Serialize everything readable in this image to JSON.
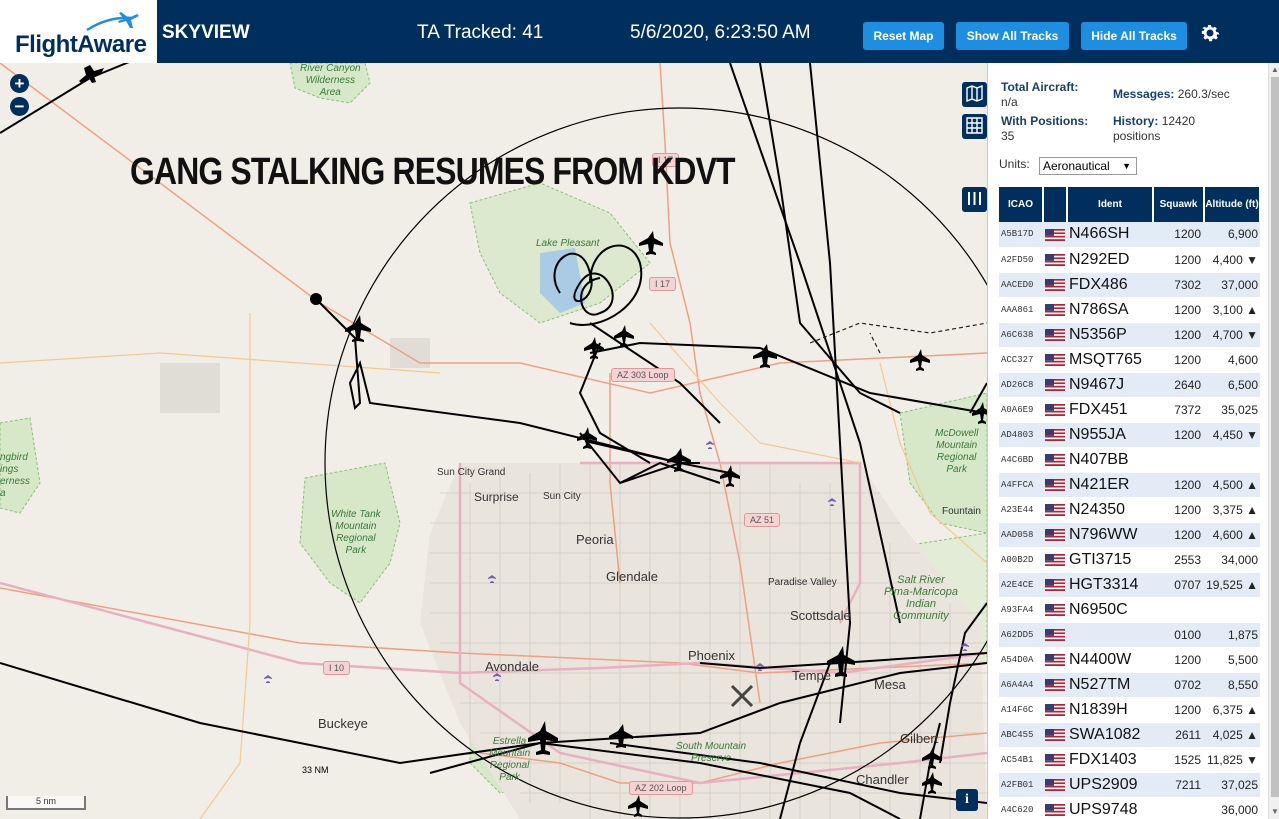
{
  "header": {
    "logo_text": "FlightAware",
    "app_name": "SKYVIEW",
    "ta_tracked": "TA Tracked: 41",
    "datetime": "5/6/2020, 6:23:50 AM",
    "reset_label": "Reset Map",
    "show_label": "Show All Tracks",
    "hide_label": "Hide All Tracks",
    "accent_color": "#1e8fe0",
    "bar_color": "#002f5d"
  },
  "map": {
    "overlay_title": "GANG STALKING RESUMES FROM KDVT",
    "range_ring_label": "33 NM",
    "scale_label": "5 nm",
    "zoom_in": "+",
    "zoom_out": "−",
    "info": "i",
    "places": {
      "surprise": "Surprise",
      "sun_city": "Sun City",
      "sun_city_grand": "Sun City Grand",
      "peoria": "Peoria",
      "glendale": "Glendale",
      "phoenix": "Phoenix",
      "tempe": "Tempe",
      "mesa": "Mesa",
      "scottsdale": "Scottsdale",
      "paradise_valley": "Paradise Valley",
      "avondale": "Avondale",
      "buckeye": "Buckeye",
      "gilbert": "Gilbert",
      "chandler": "Chandler",
      "fountain": "Fountain"
    },
    "parks": {
      "hassayampa": "River Canyon\nWilderness\nArea",
      "white_tank": "White Tank\nMountain\nRegional\nPark",
      "mcdowell": "McDowell\nMountain\nRegional\nPark",
      "estrella": "Estrella\nMountain\nRegional\nPark",
      "south_mountain": "South Mountain\nPreserve",
      "lake_pleasant": "Lake Pleasant",
      "hummingbird": "ngbird\nings\nerness\na",
      "srpmic": "Salt River\nPima-Maricopa\nIndian\nCommunity"
    },
    "highways": {
      "i17_north": "I 17",
      "i17_mid": "I 17",
      "az303": "AZ 303 Loop",
      "az51": "AZ 51",
      "i10": "I 10",
      "az202": "AZ 202 Loop"
    }
  },
  "stats": {
    "total_label": "Total Aircraft:",
    "total_value": "n/a",
    "messages_label": "Messages:",
    "messages_value": "260.3/sec",
    "positions_label": "With Positions:",
    "positions_value": "35",
    "history_label": "History:",
    "history_value": "12420 positions"
  },
  "units": {
    "label": "Units:",
    "selected": "Aeronautical"
  },
  "table": {
    "headers": {
      "icao": "ICAO",
      "ident": "Ident",
      "squawk": "Squawk",
      "altitude": "Altitude (ft)"
    },
    "rows": [
      {
        "icao": "A5B17D",
        "ident": "N466SH",
        "squawk": "1200",
        "alt": "6,900"
      },
      {
        "icao": "A2FD50",
        "ident": "N292ED",
        "squawk": "1200",
        "alt": "4,400 ▼"
      },
      {
        "icao": "AACED0",
        "ident": "FDX486",
        "squawk": "7302",
        "alt": "37,000"
      },
      {
        "icao": "AAA861",
        "ident": "N786SA",
        "squawk": "1200",
        "alt": "3,100 ▲"
      },
      {
        "icao": "A6C638",
        "ident": "N5356P",
        "squawk": "1200",
        "alt": "4,700 ▼"
      },
      {
        "icao": "ACC327",
        "ident": "MSQT765",
        "squawk": "1200",
        "alt": "4,600"
      },
      {
        "icao": "AD26C8",
        "ident": "N9467J",
        "squawk": "2640",
        "alt": "6,500"
      },
      {
        "icao": "A0A6E9",
        "ident": "FDX451",
        "squawk": "7372",
        "alt": "35,025"
      },
      {
        "icao": "AD4803",
        "ident": "N955JA",
        "squawk": "1200",
        "alt": "4,450 ▼"
      },
      {
        "icao": "A4C6BD",
        "ident": "N407BB",
        "squawk": "",
        "alt": ""
      },
      {
        "icao": "A4FFCA",
        "ident": "N421ER",
        "squawk": "1200",
        "alt": "4,500 ▲"
      },
      {
        "icao": "A23E44",
        "ident": "N24350",
        "squawk": "1200",
        "alt": "3,375 ▲"
      },
      {
        "icao": "AAD058",
        "ident": "N796WW",
        "squawk": "1200",
        "alt": "4,600 ▲"
      },
      {
        "icao": "A00B2D",
        "ident": "GTI3715",
        "squawk": "2553",
        "alt": "34,000"
      },
      {
        "icao": "A2E4CE",
        "ident": "HGT3314",
        "squawk": "0707",
        "alt": "19,525 ▲"
      },
      {
        "icao": "A93FA4",
        "ident": "N6950C",
        "squawk": "",
        "alt": ""
      },
      {
        "icao": "A62DD5",
        "ident": "",
        "squawk": "0100",
        "alt": "1,875"
      },
      {
        "icao": "A54D0A",
        "ident": "N4400W",
        "squawk": "1200",
        "alt": "5,500"
      },
      {
        "icao": "A6A4A4",
        "ident": "N527TM",
        "squawk": "0702",
        "alt": "8,550"
      },
      {
        "icao": "A14F6C",
        "ident": "N1839H",
        "squawk": "1200",
        "alt": "6,375 ▲"
      },
      {
        "icao": "ABC455",
        "ident": "SWA1082",
        "squawk": "2611",
        "alt": "4,025 ▲"
      },
      {
        "icao": "AC54B1",
        "ident": "FDX1403",
        "squawk": "1525",
        "alt": "11,825 ▼"
      },
      {
        "icao": "A2FB01",
        "ident": "UPS2909",
        "squawk": "7211",
        "alt": "37,025"
      },
      {
        "icao": "A4C620",
        "ident": "UPS9748",
        "squawk": "",
        "alt": "36,000"
      }
    ]
  }
}
